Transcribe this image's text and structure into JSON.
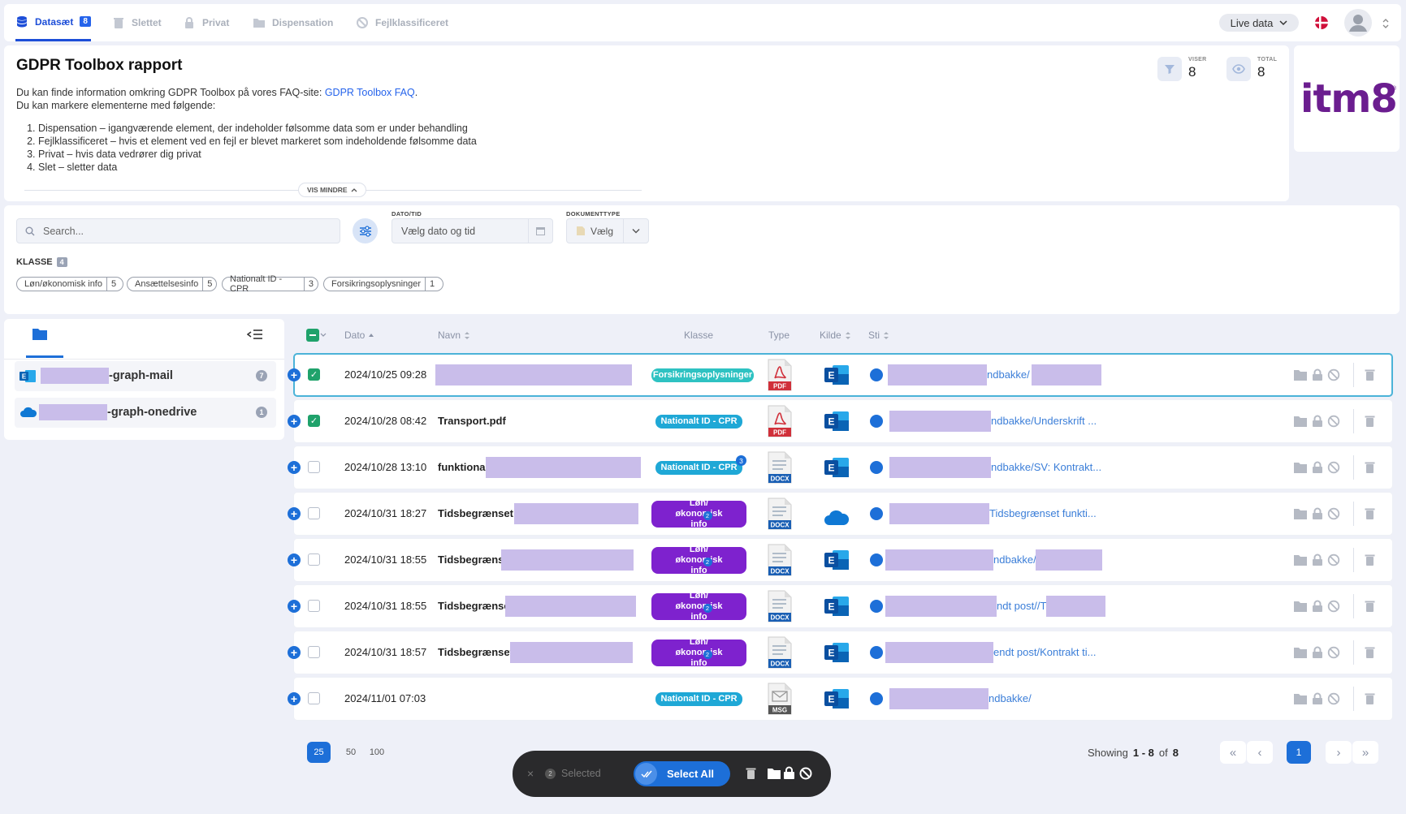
{
  "tabs": [
    {
      "label": "Datasæt",
      "count": "8",
      "icon": "database-icon"
    },
    {
      "label": "Slettet",
      "icon": "trash-icon"
    },
    {
      "label": "Privat",
      "icon": "lock-icon"
    },
    {
      "label": "Dispensation",
      "icon": "folder-icon"
    },
    {
      "label": "Fejlklassificeret",
      "icon": "ban-icon"
    }
  ],
  "header": {
    "live_label": "Live data",
    "colors": {
      "accent": "#1d4ed8"
    }
  },
  "info": {
    "title": "GDPR Toolbox rapport",
    "line1_prefix": "Du kan finde information omkring GDPR Toolbox på vores FAQ-site: ",
    "faq_link": "GDPR Toolbox FAQ",
    "line1_suffix": ".",
    "line2": "Du kan markere elementerne med følgende:",
    "list": [
      "Dispensation – igangværende element, der indeholder følsomme data som er under behandling",
      "Fejlklassificeret – hvis et element ved en fejl er blevet markeret som indeholdende følsomme data",
      "Privat – hvis data vedrører dig privat",
      "Slet – sletter data"
    ],
    "toggle_label": "VIS MINDRE",
    "stats": [
      {
        "label": "VISER",
        "value": "8",
        "icon": "filter-icon"
      },
      {
        "label": "TOTAL",
        "value": "8",
        "icon": "eye-icon"
      }
    ],
    "logo_text": "itm8"
  },
  "filters": {
    "search_placeholder": "Search...",
    "date_label": "DATO/TID",
    "date_placeholder": "Vælg dato og tid",
    "doctype_label": "DOKUMENTTYPE",
    "doctype_placeholder": "Vælg",
    "klasse_label": "KLASSE",
    "klasse_count": "4",
    "chips": [
      {
        "label": "Løn/økonomisk info",
        "count": "5"
      },
      {
        "label": "Ansættelsesinfo",
        "count": "5"
      },
      {
        "label": "Nationalt ID - CPR",
        "count": "3"
      },
      {
        "label": "Forsikringsoplysninger",
        "count": "1"
      }
    ]
  },
  "sidebar": {
    "items": [
      {
        "name_suffix": "-graph-mail",
        "count": "7",
        "icon": "outlook-icon"
      },
      {
        "name_suffix": "-graph-onedrive",
        "count": "1",
        "icon": "onedrive-icon"
      }
    ]
  },
  "table": {
    "columns": [
      "Dato",
      "Navn",
      "Klasse",
      "Type",
      "Kilde",
      "Sti"
    ],
    "rows": [
      {
        "date": "2024/10/25 09:28",
        "name": "",
        "klasse": "Forsikringsoplysninger",
        "type": "PDF",
        "source": "outlook",
        "path": "ndbakke/",
        "checked": true
      },
      {
        "date": "2024/10/28 08:42",
        "name": "Transport.pdf",
        "klasse": "Nationalt ID - CPR",
        "type": "PDF",
        "source": "outlook",
        "path": "ndbakke/Underskrift ...",
        "checked": true
      },
      {
        "date": "2024/10/28 13:10",
        "name": "funktiona",
        "klasse": "Nationalt ID - CPR",
        "klasse_sup": "3",
        "type": "DOCX",
        "source": "outlook",
        "path": "ndbakke/SV: Kontrakt...",
        "checked": false
      },
      {
        "date": "2024/10/31 18:27",
        "name": "Tidsbegrænset",
        "klasse": "Løn/økonomisk info",
        "klasse_sub": "2",
        "type": "DOCX",
        "source": "onedrive",
        "path": "Tidsbegrænset funkti...",
        "checked": false
      },
      {
        "date": "2024/10/31 18:55",
        "name": "Tidsbegræns",
        "klasse": "Løn/økonomisk info",
        "klasse_sub": "2",
        "type": "DOCX",
        "source": "outlook",
        "path": "ndbakke/",
        "checked": false
      },
      {
        "date": "2024/10/31 18:55",
        "name": "Tidsbegrænse",
        "klasse": "Løn/økonomisk info",
        "klasse_sub": "2",
        "type": "DOCX",
        "source": "outlook",
        "path": "ndt post//T",
        "checked": false
      },
      {
        "date": "2024/10/31 18:57",
        "name": "Tidsbegrænset",
        "klasse": "Løn/økonomisk info",
        "klasse_sub": "2",
        "type": "DOCX",
        "source": "outlook",
        "path": "endt post/Kontrakt ti...",
        "checked": false
      },
      {
        "date": "2024/11/01 07:03",
        "name": "",
        "klasse": "Nationalt ID - CPR",
        "type": "MSG",
        "source": "outlook",
        "path": "ndbakke/",
        "checked": false
      }
    ]
  },
  "footer": {
    "page_sizes": [
      "25",
      "50",
      "100"
    ],
    "showing_label": "Showing",
    "range": "1 - 8",
    "of_label": "of",
    "total": "8",
    "current_page": "1",
    "selected_count": "2",
    "selected_label": "Selected",
    "select_all_label": "Select All"
  }
}
